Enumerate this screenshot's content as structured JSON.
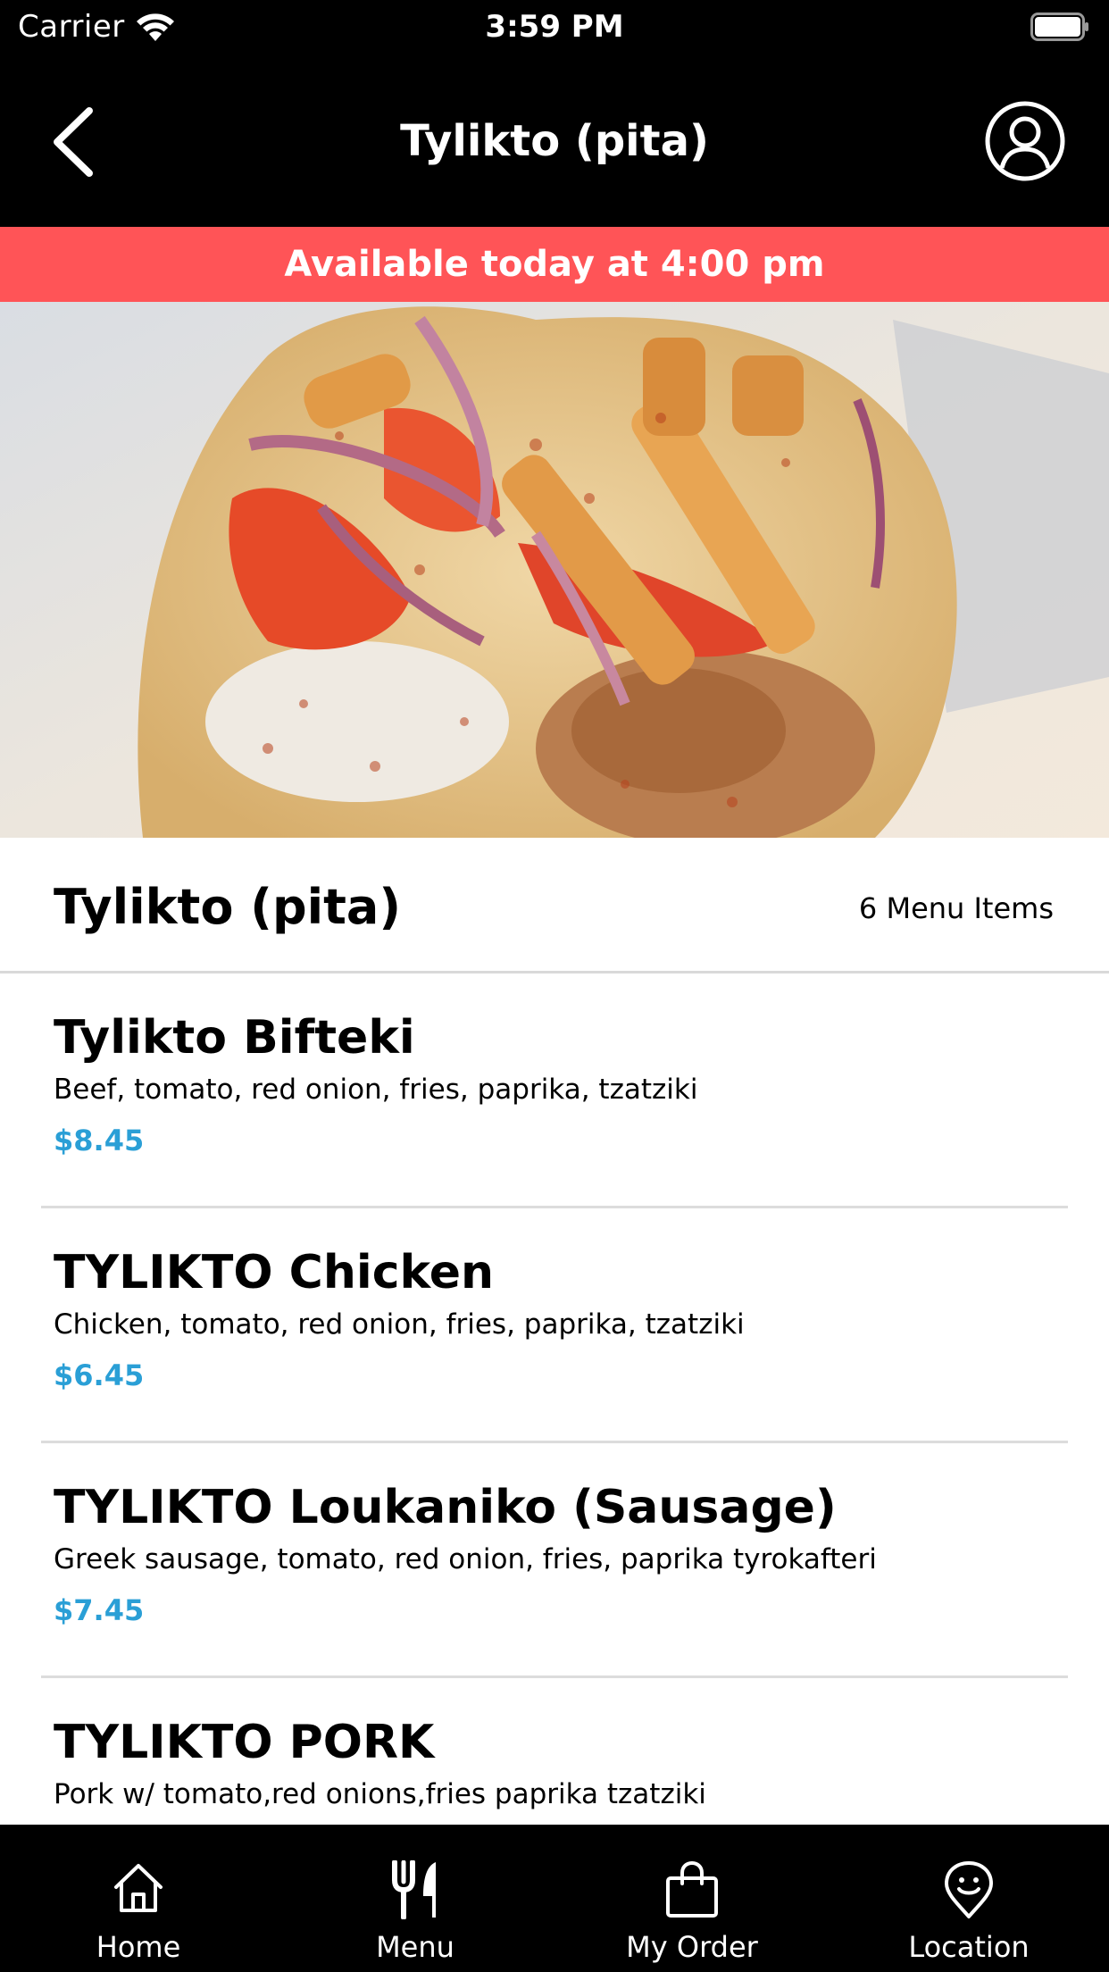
{
  "status_bar": {
    "carrier": "Carrier",
    "time": "3:59 PM"
  },
  "header": {
    "title": "Tylikto (pita)",
    "back_icon": "chevron-left-icon",
    "profile_icon": "user-circle-icon"
  },
  "availability_banner": {
    "text": "Available today at 4:00 pm",
    "color": "#ff5457"
  },
  "section": {
    "title": "Tylikto (pita)",
    "count_label": "6 Menu Items"
  },
  "menu_items": [
    {
      "name": "Tylikto Bifteki",
      "description": "Beef, tomato, red onion, fries, paprika, tzatziki",
      "price": "$8.45"
    },
    {
      "name": "TYLIKTO Chicken",
      "description": "Chicken, tomato, red onion, fries, paprika, tzatziki",
      "price": "$6.45"
    },
    {
      "name": "TYLIKTO Loukaniko (Sausage)",
      "description": "Greek sausage, tomato, red onion, fries, paprika tyrokafteri",
      "price": "$7.45"
    },
    {
      "name": "TYLIKTO PORK",
      "description": "Pork w/ tomato,red onions,fries paprika tzatziki",
      "price": ""
    }
  ],
  "price_color": "#2a9fd6",
  "tab_bar": {
    "tabs": [
      {
        "label": "Home",
        "icon": "home-icon"
      },
      {
        "label": "Menu",
        "icon": "fork-knife-icon"
      },
      {
        "label": "My Order",
        "icon": "shopping-bag-icon"
      },
      {
        "label": "Location",
        "icon": "location-pin-icon"
      }
    ]
  }
}
